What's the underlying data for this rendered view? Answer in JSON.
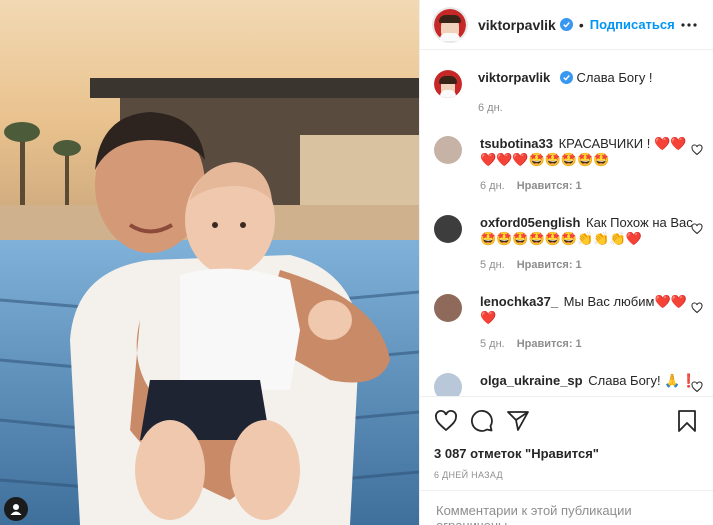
{
  "post": {
    "author": "viktorpavlik",
    "follow_label": "Подписаться",
    "dot": "•",
    "caption": "Слава Богу !",
    "caption_time": "6 дн."
  },
  "comments": [
    {
      "user": "tsubotina33",
      "text": "КРАСАВЧИКИ ! ❤️❤️",
      "text2": "❤️❤️❤️🤩🤩🤩🤩🤩",
      "time": "6 дн.",
      "likes": "Нравится: 1"
    },
    {
      "user": "oxford05english",
      "text": "Как Похож на Вас",
      "text2": "🤩🤩🤩🤩🤩🤩👏👏👏❤️",
      "time": "5 дн.",
      "likes": "Нравится: 1"
    },
    {
      "user": "lenochka37_",
      "text": "Мы Вас любим❤️❤️",
      "text2": "❤️",
      "time": "5 дн.",
      "likes": "Нравится: 1"
    },
    {
      "user": "olga_ukraine_sp",
      "text": "Слава Богу! 🙏❗",
      "text2": "",
      "time": "",
      "likes": ""
    }
  ],
  "likes_text": "3 087 отметок \"Нравится\"",
  "date_text": "6 ДНЕЙ НАЗАД",
  "footer_text": "Комментарии к этой публикации ограничены.",
  "icons": [
    "more-icon",
    "heart-icon",
    "comment-icon",
    "share-icon",
    "bookmark-icon",
    "user-tag-icon",
    "verified-icon"
  ],
  "colors": {
    "accent": "#0095f6",
    "verified": "#3897f0",
    "muted": "#8e8e8e"
  }
}
